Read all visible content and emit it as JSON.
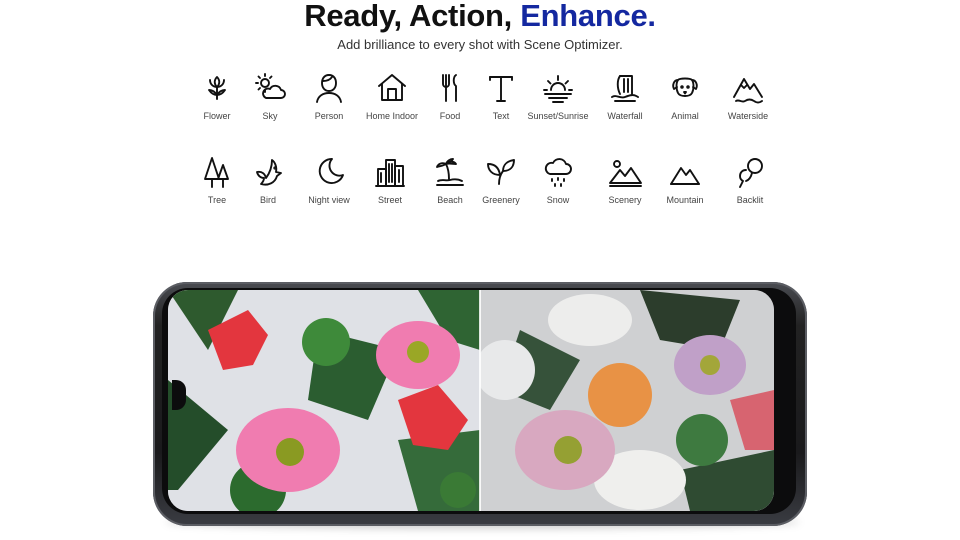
{
  "headline": {
    "part1": "Ready, ",
    "part2": "Action, ",
    "part3": "Enhance."
  },
  "subtitle": "Add brilliance to every shot with Scene Optimizer.",
  "colors": {
    "accent": "#1428a0",
    "text": "#111111"
  },
  "scenes_row1": [
    {
      "label": "Flower",
      "icon": "flower-icon"
    },
    {
      "label": "Sky",
      "icon": "sky-icon"
    },
    {
      "label": "Person",
      "icon": "person-icon"
    },
    {
      "label": "Home Indoor",
      "icon": "home-indoor-icon"
    },
    {
      "label": "Food",
      "icon": "food-icon"
    },
    {
      "label": "Text",
      "icon": "text-icon"
    },
    {
      "label": "Sunset/Sunrise",
      "icon": "sunset-icon"
    },
    {
      "label": "Waterfall",
      "icon": "waterfall-icon"
    },
    {
      "label": "Animal",
      "icon": "animal-icon"
    },
    {
      "label": "Waterside",
      "icon": "waterside-icon"
    }
  ],
  "scenes_row2": [
    {
      "label": "Tree",
      "icon": "tree-icon"
    },
    {
      "label": "Bird",
      "icon": "bird-icon"
    },
    {
      "label": "Night view",
      "icon": "night-view-icon"
    },
    {
      "label": "Street",
      "icon": "street-icon"
    },
    {
      "label": "Beach",
      "icon": "beach-icon"
    },
    {
      "label": "Greenery",
      "icon": "greenery-icon"
    },
    {
      "label": "Snow",
      "icon": "snow-icon"
    },
    {
      "label": "Scenery",
      "icon": "scenery-icon"
    },
    {
      "label": "Mountain",
      "icon": "mountain-icon"
    },
    {
      "label": "Backlit",
      "icon": "backlit-icon"
    }
  ]
}
